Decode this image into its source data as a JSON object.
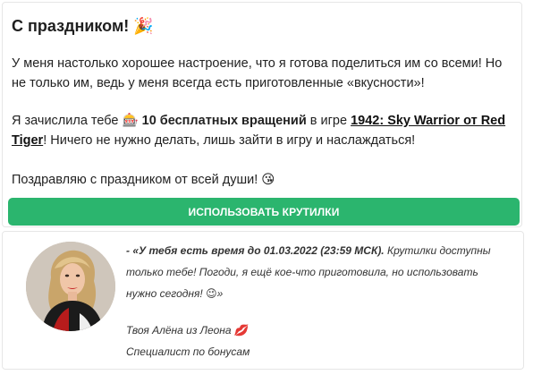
{
  "card": {
    "title": "С праздником!",
    "title_emoji": "🎉",
    "p1": "У меня настолько хорошее настроение, что я готова поделиться им со всеми! Но не только им, ведь у меня всегда есть приготовленные «вкусности»!",
    "p2_a": "Я зачислила тебе ",
    "p2_emoji": "🎰",
    "p2_bold": "10 бесплатных вращений",
    "p2_b": " в игре ",
    "p2_link": "1942: Sky Warrior от Red Tiger",
    "p2_c": "! Ничего не нужно делать, лишь зайти в игру и наслаждаться!",
    "p3": "Поздравляю с праздником от всей души! ",
    "p3_emoji": "😘",
    "cta_label": "ИСПОЛЬЗОВАТЬ КРУТИЛКИ"
  },
  "note": {
    "quote_bold": "- «У тебя есть время до 01.03.2022 (23:59 МСК).",
    "quote_rest": " Крутилки доступны только тебе! Погоди, я ещё кое-что приготовила, но использовать нужно сегодня! ",
    "quote_emoji": "😉",
    "quote_end": "»",
    "signature": "Твоя Алёна из Леона ",
    "signature_emoji": "💋",
    "role": "Специалист по бонусам"
  },
  "colors": {
    "cta_bg": "#2bb56e",
    "cta_text": "#ffffff"
  }
}
